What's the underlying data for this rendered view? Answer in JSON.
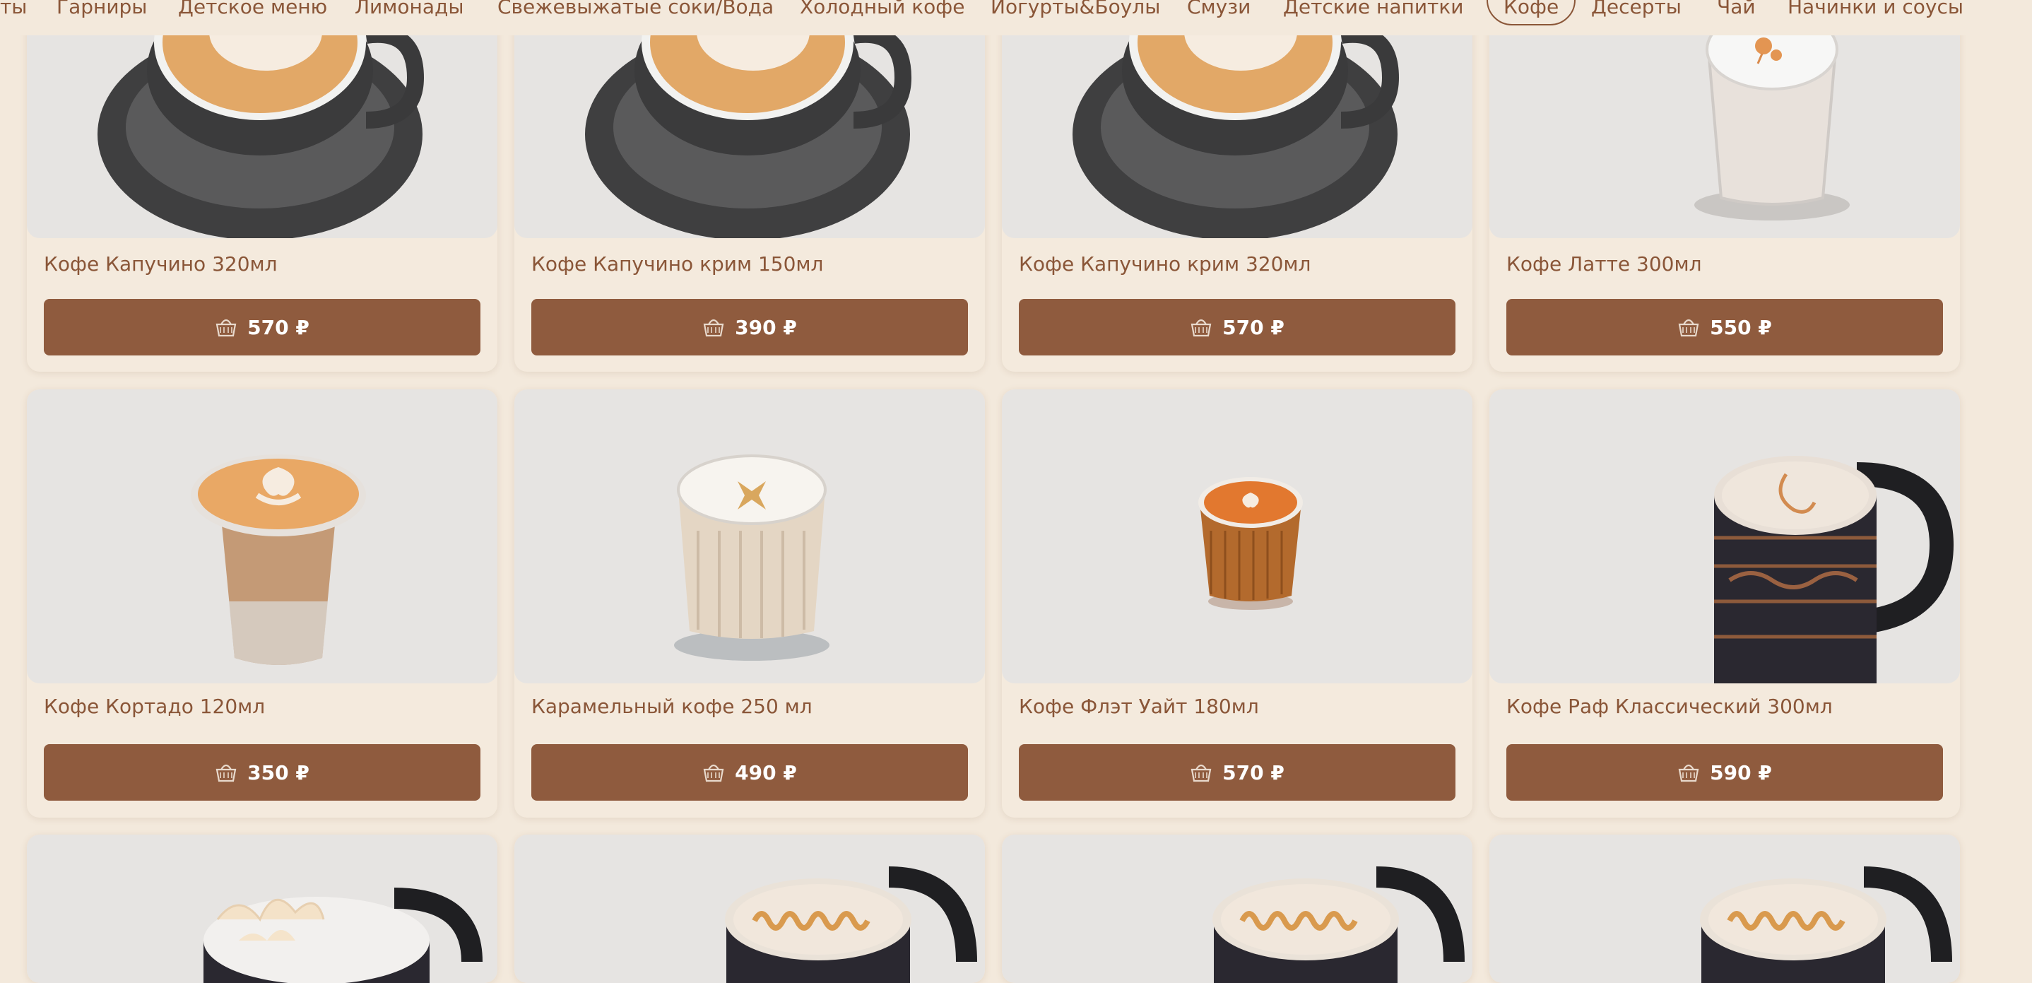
{
  "nav": {
    "items": [
      {
        "label": "ты"
      },
      {
        "label": "Гарниры"
      },
      {
        "label": "Детское меню"
      },
      {
        "label": "Лимонады"
      },
      {
        "label": "Свежевыжатые соки/Вода"
      },
      {
        "label": "Холодный кофе"
      },
      {
        "label": "Йогурты&Боулы"
      },
      {
        "label": "Смузи"
      },
      {
        "label": "Детские напитки"
      },
      {
        "label": "Кофе",
        "active": true
      },
      {
        "label": "Десерты"
      },
      {
        "label": "Чай"
      },
      {
        "label": "Начинки и соусы"
      }
    ]
  },
  "products": [
    {
      "title": "Кофе Капучино 320мл",
      "price": "570 ₽",
      "image": "cappuccino-cup-photo"
    },
    {
      "title": "Кофе Капучино крим 150мл",
      "price": "390 ₽",
      "image": "cappuccino-cup-photo"
    },
    {
      "title": "Кофе Капучино крим 320мл",
      "price": "570 ₽",
      "image": "cappuccino-cup-photo"
    },
    {
      "title": "Кофе Латте 300мл",
      "price": "550 ₽",
      "image": "latte-glass-photo"
    },
    {
      "title": "Кофе Кортадо 120мл",
      "price": "350 ₽",
      "image": "cortado-glass-photo"
    },
    {
      "title": "Карамельный кофе 250 мл",
      "price": "490 ₽",
      "image": "caramel-coffee-photo"
    },
    {
      "title": "Кофе Флэт Уайт 180мл",
      "price": "570 ₽",
      "image": "flat-white-photo"
    },
    {
      "title": "Кофе Раф Классический 300мл",
      "price": "590 ₽",
      "image": "raf-mug-photo"
    },
    {
      "title": "",
      "price": "",
      "image": "coconut-raf-mug-photo"
    },
    {
      "title": "",
      "price": "",
      "image": "caramel-raf-mug-photo"
    },
    {
      "title": "",
      "price": "",
      "image": "caramel-raf-mug-photo"
    },
    {
      "title": "",
      "price": "",
      "image": "caramel-raf-mug-photo"
    }
  ],
  "icons": {
    "price_button": "basket-icon"
  },
  "colors": {
    "accent": "#8f5b3e",
    "background": "#f3e9dc",
    "text": "#8a5638"
  }
}
